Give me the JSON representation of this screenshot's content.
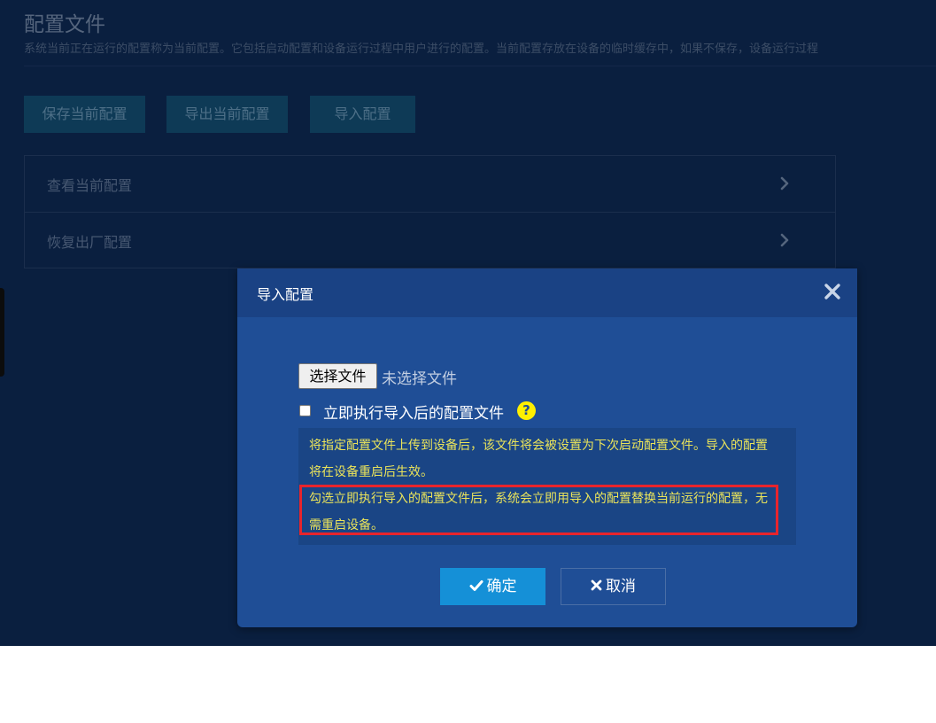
{
  "page": {
    "title": "配置文件",
    "description": "系统当前正在运行的配置称为当前配置。它包括启动配置和设备运行过程中用户进行的配置。当前配置存放在设备的临时缓存中，如果不保存，设备运行过程"
  },
  "toolbar": {
    "save_label": "保存当前配置",
    "export_label": "导出当前配置",
    "import_label": "导入配置"
  },
  "panel": {
    "items": [
      {
        "label": "查看当前配置",
        "icon": "chevron-right-icon"
      },
      {
        "label": "恢复出厂配置",
        "icon": "chevron-right-icon"
      }
    ]
  },
  "modal": {
    "title": "导入配置",
    "close_icon": "close-icon",
    "file_button_label": "选择文件",
    "file_status": "未选择文件",
    "checkbox_label": "立即执行导入后的配置文件",
    "checkbox_checked": false,
    "help_icon": "?",
    "tip_1": "将指定配置文件上传到设备后，该文件将会被设置为下次启动配置文件。导入的配置将在设备重启后生效。",
    "tip_2": "勾选立即执行导入的配置文件后，系统会立即用导入的配置替换当前运行的配置，无需重启设备。",
    "ok_label": "确定",
    "cancel_label": "取消"
  },
  "colors": {
    "background": "#0a1f3f",
    "modal": "#1f4e96",
    "modal_header": "#1a4284",
    "tip_text": "#eae35a",
    "highlight": "#e8242c",
    "primary_button": "#1590d7",
    "help_icon": "#ffef00"
  }
}
